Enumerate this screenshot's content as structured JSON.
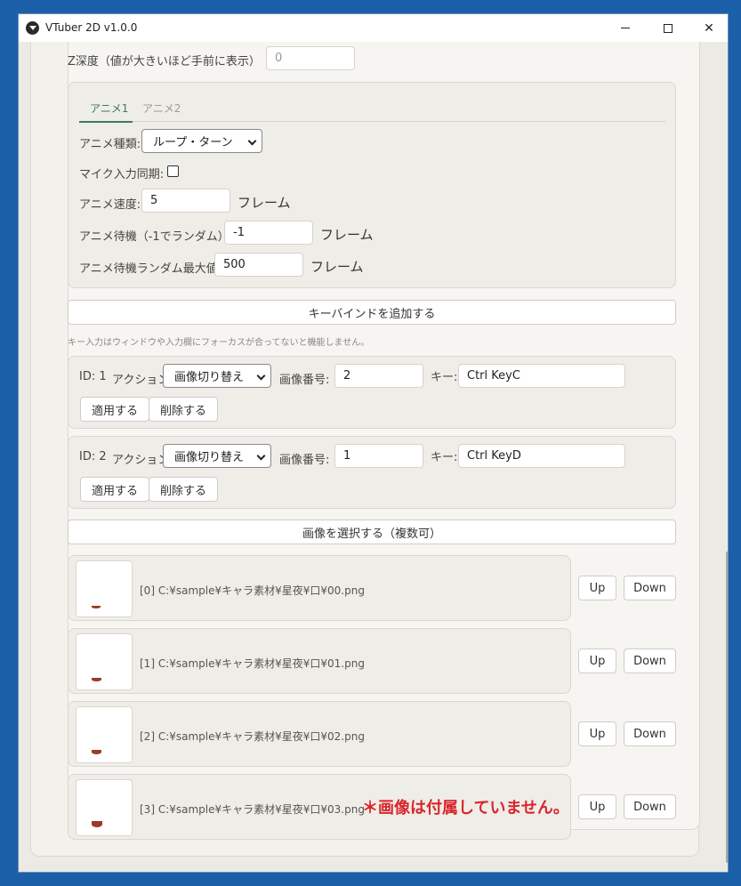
{
  "window": {
    "title": "VTuber 2D v1.0.0",
    "minimize": "—",
    "maximize": "☐",
    "close": "✕"
  },
  "zdepth": {
    "label": "Z深度（値が大きいほど手前に表示）",
    "value": "0"
  },
  "anim_tabs": [
    {
      "label": "アニメ1",
      "active": true
    },
    {
      "label": "アニメ2",
      "active": false
    }
  ],
  "anim": {
    "type_label": "アニメ種類:",
    "type_value": "ループ・ターン",
    "mic_label": "マイク入力同期:",
    "mic_checked": false,
    "speed_label": "アニメ速度:",
    "speed_value": "5",
    "speed_unit": "フレーム",
    "wait_label": "アニメ待機（-1でランダム）:",
    "wait_value": "-1",
    "wait_unit": "フレーム",
    "wait_max_label": "アニメ待機ランダム最大値:",
    "wait_max_value": "500",
    "wait_max_unit": "フレーム"
  },
  "keybind": {
    "add_button": "キーバインドを追加する",
    "hint": "キー入力はウィンドウや入力欄にフォーカスが合ってないと機能しません。",
    "items": [
      {
        "id_label": "ID: 1",
        "action_label": "アクション:",
        "action_value": "画像切り替え",
        "image_no_label": "画像番号:",
        "image_no_value": "2",
        "key_label": "キー:",
        "key_value": "Ctrl KeyC",
        "apply": "適用する",
        "delete": "削除する"
      },
      {
        "id_label": "ID: 2",
        "action_label": "アクション:",
        "action_value": "画像切り替え",
        "image_no_label": "画像番号:",
        "image_no_value": "1",
        "key_label": "キー:",
        "key_value": "Ctrl KeyD",
        "apply": "適用する",
        "delete": "削除する"
      }
    ]
  },
  "images": {
    "select_button": "画像を選択する（複数可）",
    "items": [
      {
        "path": "[0] C:¥sample¥キャラ素材¥星夜¥口¥00.png",
        "up": "Up",
        "down": "Down"
      },
      {
        "path": "[1] C:¥sample¥キャラ素材¥星夜¥口¥01.png",
        "up": "Up",
        "down": "Down"
      },
      {
        "path": "[2] C:¥sample¥キャラ素材¥星夜¥口¥02.png",
        "up": "Up",
        "down": "Down"
      },
      {
        "path": "[3] C:¥sample¥キャラ素材¥星夜¥口¥03.png",
        "up": "Up",
        "down": "Down"
      }
    ],
    "note": "＊画像は付属していません。"
  },
  "colors": {
    "accent": "#3d7a5e",
    "note": "#d8262d",
    "desktop": "#1b5fa8"
  }
}
